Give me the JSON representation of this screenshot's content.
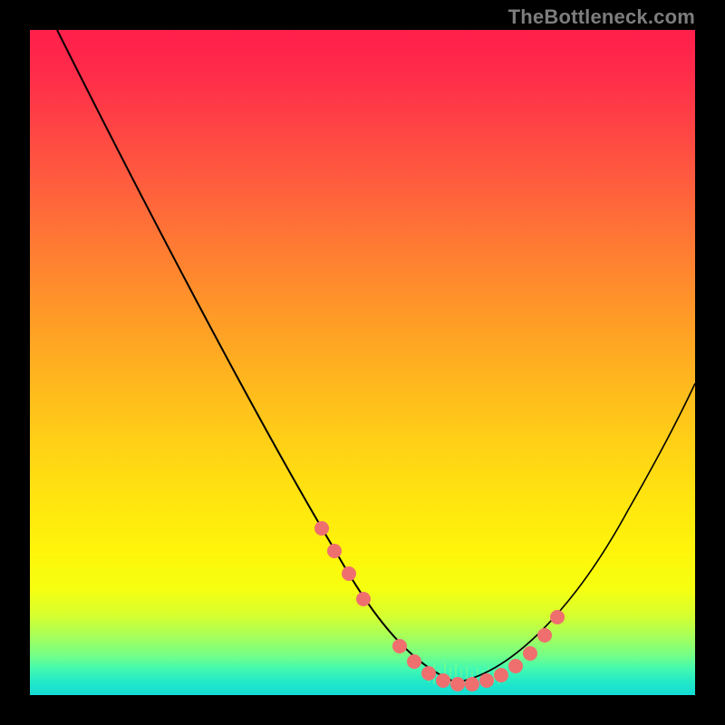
{
  "watermark": "TheBottleneck.com",
  "colors": {
    "background": "#000000",
    "curve": "#000000",
    "markers": "#ef6f6f",
    "gradient_top": "#ff1f4b",
    "gradient_bottom": "#14dcd6"
  },
  "chart_data": {
    "type": "line",
    "title": "",
    "xlabel": "",
    "ylabel": "",
    "xlim": [
      0,
      100
    ],
    "ylim": [
      0,
      100
    ],
    "series": [
      {
        "name": "bottleneck-curve",
        "x": [
          4,
          8,
          12,
          16,
          20,
          24,
          28,
          32,
          36,
          40,
          44,
          48,
          50,
          52,
          54,
          56,
          58,
          60,
          62,
          64,
          66,
          68,
          72,
          76,
          80,
          84,
          88,
          92,
          96,
          100
        ],
        "y": [
          100,
          93,
          86,
          79,
          72,
          65,
          58,
          51,
          45,
          38,
          31,
          24,
          20,
          16,
          12,
          8,
          5,
          3,
          2,
          1,
          1,
          2,
          4,
          8,
          14,
          22,
          30,
          38,
          46,
          54
        ]
      }
    ],
    "markers": {
      "name": "highlighted-points",
      "x": [
        44,
        46,
        48,
        50,
        56,
        58,
        60,
        62,
        64,
        66,
        68,
        70,
        72,
        74,
        76,
        78
      ],
      "y": [
        31,
        27.5,
        24,
        20,
        8,
        5,
        3,
        2,
        1,
        1,
        2,
        3,
        4,
        6,
        8,
        11
      ]
    },
    "noise_band": {
      "x_range": [
        60,
        72
      ],
      "amplitude": 3
    }
  }
}
